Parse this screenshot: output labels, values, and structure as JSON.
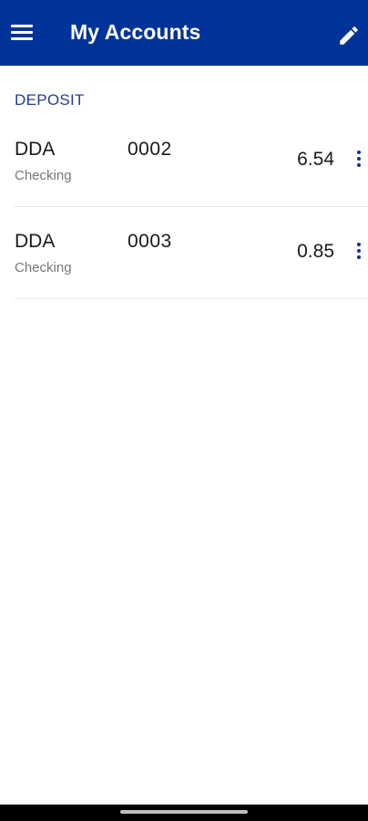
{
  "header": {
    "title": "My Accounts",
    "menu_icon": "hamburger-menu-icon",
    "edit_icon": "pencil-edit-icon",
    "bg_color": "#003399"
  },
  "section": {
    "title": "DEPOSIT",
    "color": "#23408e"
  },
  "accounts": [
    {
      "name": "DDA",
      "type": "Checking",
      "number": "0002",
      "balance": "6.54"
    },
    {
      "name": "DDA",
      "type": "Checking",
      "number": "0003",
      "balance": "0.85"
    }
  ]
}
